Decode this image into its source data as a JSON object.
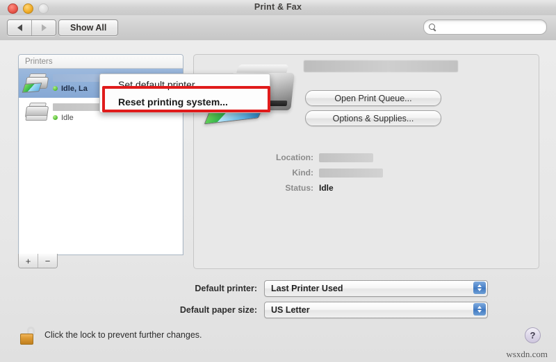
{
  "window": {
    "title": "Print & Fax",
    "traffic_lights": [
      "close",
      "minimize",
      "zoom"
    ]
  },
  "toolbar": {
    "back_label": "back-arrow",
    "forward_label": "forward-arrow",
    "show_all_label": "Show All",
    "search_value": "",
    "search_placeholder": ""
  },
  "printer_list": {
    "header": "Printers",
    "items": [
      {
        "name_redacted": true,
        "status": "Idle, La",
        "selected": true,
        "status_color": "#5bc23a"
      },
      {
        "name_redacted": true,
        "status": "Idle",
        "selected": false,
        "status_color": "#5bc23a"
      }
    ],
    "add_button": "+",
    "remove_button": "−"
  },
  "context_menu": {
    "items": [
      {
        "label": "Set default printer",
        "highlighted": false
      },
      {
        "label": "Reset printing system...",
        "highlighted": true
      }
    ],
    "highlight_color": "#e01b1b"
  },
  "detail": {
    "printer_name_redacted": true,
    "buttons": [
      "Open Print Queue...",
      "Options & Supplies..."
    ],
    "fields": [
      {
        "label": "Location:",
        "value": "",
        "redacted": true
      },
      {
        "label": "Kind:",
        "value": "",
        "redacted": true
      },
      {
        "label": "Status:",
        "value": "Idle",
        "redacted": false
      }
    ]
  },
  "preferences": [
    {
      "label": "Default printer:",
      "value": "Last Printer Used"
    },
    {
      "label": "Default paper size:",
      "value": "US Letter"
    }
  ],
  "footer": {
    "lock_text": "Click the lock to prevent further changes.",
    "lock_state": "unlocked",
    "help_label": "?",
    "watermark": "wsxdn.com"
  }
}
